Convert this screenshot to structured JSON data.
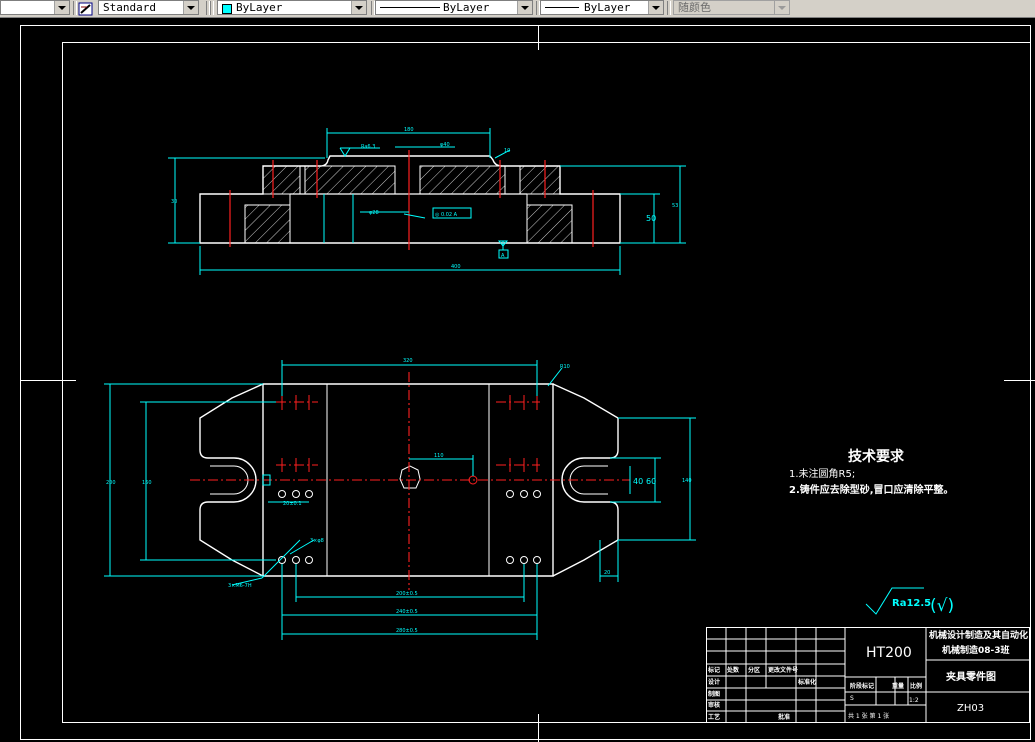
{
  "toolbar": {
    "text_style": "Standard",
    "layer_color": "ByLayer",
    "linetype": "ByLayer",
    "lineweight": "ByLayer",
    "plot_style": "随颜色"
  },
  "drawing": {
    "tech_req_title": "技术要求",
    "tech_req_1": "1.未注圆角R5;",
    "tech_req_2": "2.铸件应去除型砂,冒口应清除平整。",
    "roughness_symbol": "Ra12.5",
    "roughness_paren": "(√)",
    "material": "HT200",
    "school": "机械设计制造及其自动化",
    "class_name": "机械制造08-3班",
    "part_name": "夹具零件图",
    "drawing_no": "ZH03",
    "tb_labels": {
      "revision": "标记",
      "count": "处数",
      "zone": "分区",
      "doc_no": "更改文件号",
      "signature": "签名",
      "date": "年月日",
      "design": "设计",
      "standardize": "标准化",
      "stage": "阶段标记",
      "weight": "重量",
      "scale": "比例",
      "check": "审核",
      "process": "工艺",
      "approve": "批准",
      "drafting": "制图",
      "scale_value": "1:2",
      "sheet_row": "共 1 张  第 1 张",
      "mark": "S"
    },
    "dims": {
      "top_180": "180",
      "top_ra": "Ra6.3",
      "top_phi": "φ40",
      "top_height": "30",
      "top_10": "10",
      "top_width": "400",
      "top_50": "50",
      "top_53": "53",
      "top_phi2": "φ28",
      "top_datum": "A",
      "top_tol": "◎ 0.02 A",
      "front_width": "320",
      "front_height_a": "200",
      "front_height_b": "160",
      "front_hole": "110",
      "front_40": "40",
      "front_60": "60",
      "front_right": "140",
      "front_20": "20",
      "bot_1": "200±0.5",
      "bot_2": "240±0.5",
      "bot_3": "280±0.5",
      "holes_1": "3×M6-7H",
      "holes_2": "3×φ8",
      "small_dim": "20±0.1",
      "corner": "R10"
    }
  }
}
